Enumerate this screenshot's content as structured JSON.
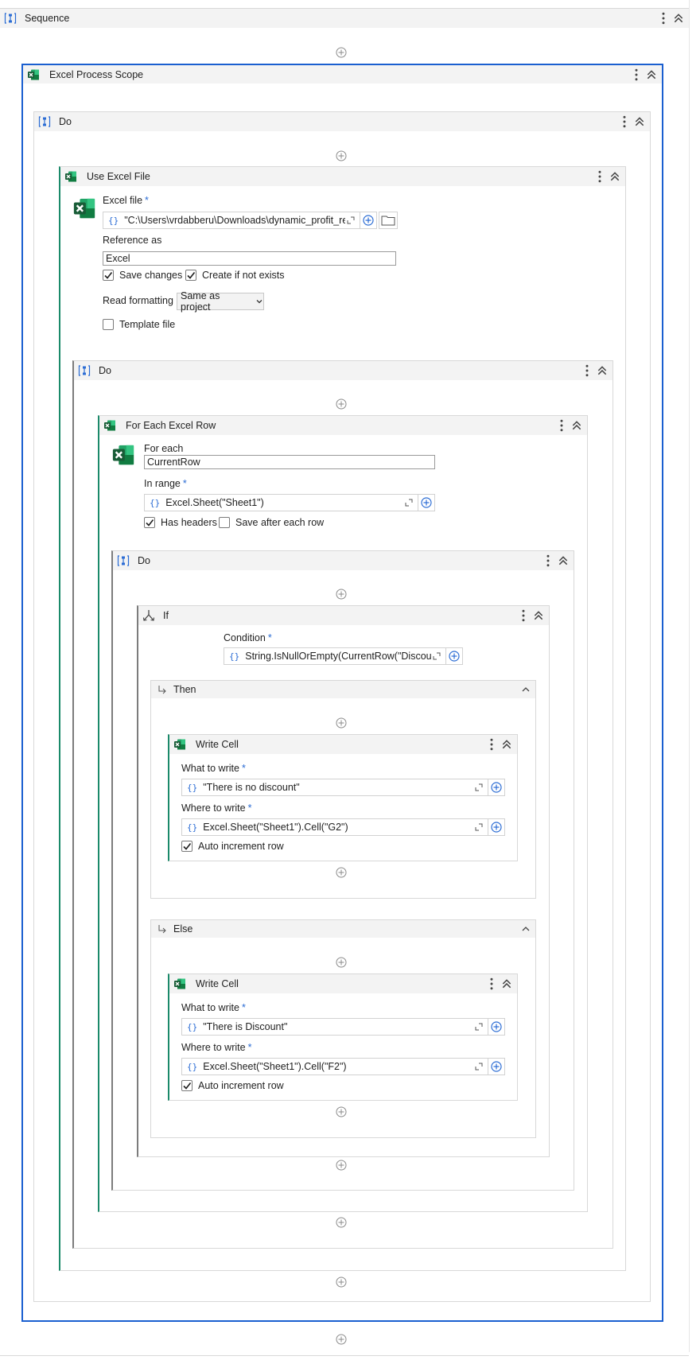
{
  "sequence": {
    "title": "Sequence"
  },
  "excel_process_scope": {
    "title": "Excel Process Scope"
  },
  "do_outer": {
    "title": "Do"
  },
  "use_excel_file": {
    "title": "Use Excel File",
    "excel_file_label": "Excel file",
    "excel_file_value": "\"C:\\Users\\vrdabberu\\Downloads\\dynamic_profit_re",
    "reference_as_label": "Reference as",
    "reference_as_value": "Excel",
    "save_changes_label": "Save changes",
    "save_changes_checked": true,
    "create_if_not_exists_label": "Create if not exists",
    "create_if_not_exists_checked": true,
    "read_formatting_label": "Read formatting",
    "read_formatting_value": "Same as project",
    "template_file_label": "Template file",
    "template_file_checked": false
  },
  "do_mid": {
    "title": "Do"
  },
  "for_each_excel_row": {
    "title": "For Each Excel Row",
    "for_each_label": "For each",
    "for_each_value": "CurrentRow",
    "in_range_label": "In range",
    "in_range_value": "Excel.Sheet(\"Sheet1\")",
    "has_headers_label": "Has headers",
    "has_headers_checked": true,
    "save_after_each_row_label": "Save after each row",
    "save_after_each_row_checked": false
  },
  "do_inner": {
    "title": "Do"
  },
  "if_activity": {
    "title": "If",
    "condition_label": "Condition",
    "condition_value": "String.IsNullOrEmpty(CurrentRow(\"Discour",
    "then_label": "Then",
    "else_label": "Else"
  },
  "write_cell_then": {
    "title": "Write Cell",
    "what_label": "What to write",
    "what_value": "\"There is no discount\"",
    "where_label": "Where to write",
    "where_value": "Excel.Sheet(\"Sheet1\").Cell(\"G2\")",
    "auto_increment_label": "Auto increment row",
    "auto_increment_checked": true
  },
  "write_cell_else": {
    "title": "Write Cell",
    "what_label": "What to write",
    "what_value": "\"There is Discount\"",
    "where_label": "Where to write",
    "where_value": "Excel.Sheet(\"Sheet1\").Cell(\"F2\")",
    "auto_increment_label": "Auto increment row",
    "auto_increment_checked": true
  },
  "required_mark": "*",
  "colors": {
    "accent_blue": "#2b6cd4",
    "selection_border": "#1a5fd0",
    "excel_green": "#1b7d45",
    "activity_sidebar_green": "#1b8a6a"
  },
  "icons": {
    "sequence": "sequence-icon",
    "excel": "excel-icon",
    "if": "branch-icon",
    "add": "plus-circle-icon",
    "kebab": "kebab-icon",
    "collapse": "double-chevron-up-icon",
    "expand_editor": "expand-icon",
    "folder": "folder-icon"
  }
}
